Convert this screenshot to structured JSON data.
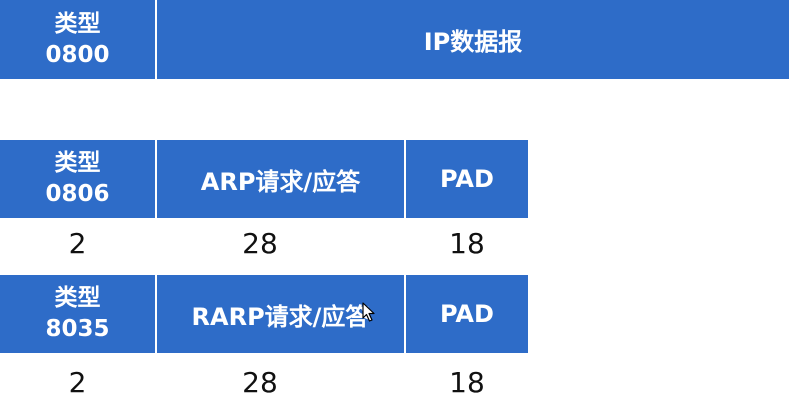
{
  "row_ip": {
    "type_label": "类型",
    "type_code": "0800",
    "payload": "IP数据报"
  },
  "row_arp": {
    "type_label": "类型",
    "type_code": "0806",
    "payload": "ARP请求/应答",
    "pad": "PAD",
    "sizes": [
      "2",
      "28",
      "18"
    ]
  },
  "row_rarp": {
    "type_label": "类型",
    "type_code": "8035",
    "payload": "RARP请求/应答",
    "pad": "PAD",
    "sizes": [
      "2",
      "28",
      "18"
    ]
  },
  "colors": {
    "cell_fill": "#2e6cc8",
    "cell_text": "#ffffff",
    "size_text": "#111111"
  },
  "icons": {
    "pointer": "mouse-pointer-icon"
  }
}
